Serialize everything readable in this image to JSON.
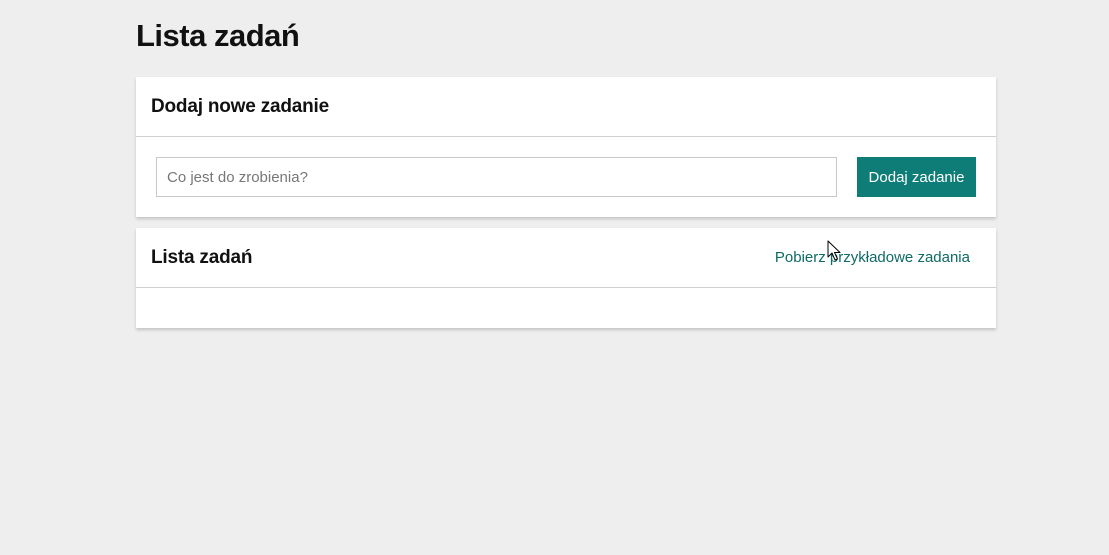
{
  "page": {
    "title": "Lista zadań"
  },
  "add_panel": {
    "title": "Dodaj nowe zadanie",
    "input_placeholder": "Co jest do zrobienia?",
    "input_value": "",
    "button_label": "Dodaj zadanie"
  },
  "list_panel": {
    "title": "Lista zadań",
    "fetch_link_label": "Pobierz przykładowe zadania",
    "tasks": []
  },
  "colors": {
    "accent": "#0e7d78",
    "link": "#0e6b66",
    "background": "#eeeeee"
  },
  "icons": {
    "cursor": "mouse-pointer-icon"
  }
}
